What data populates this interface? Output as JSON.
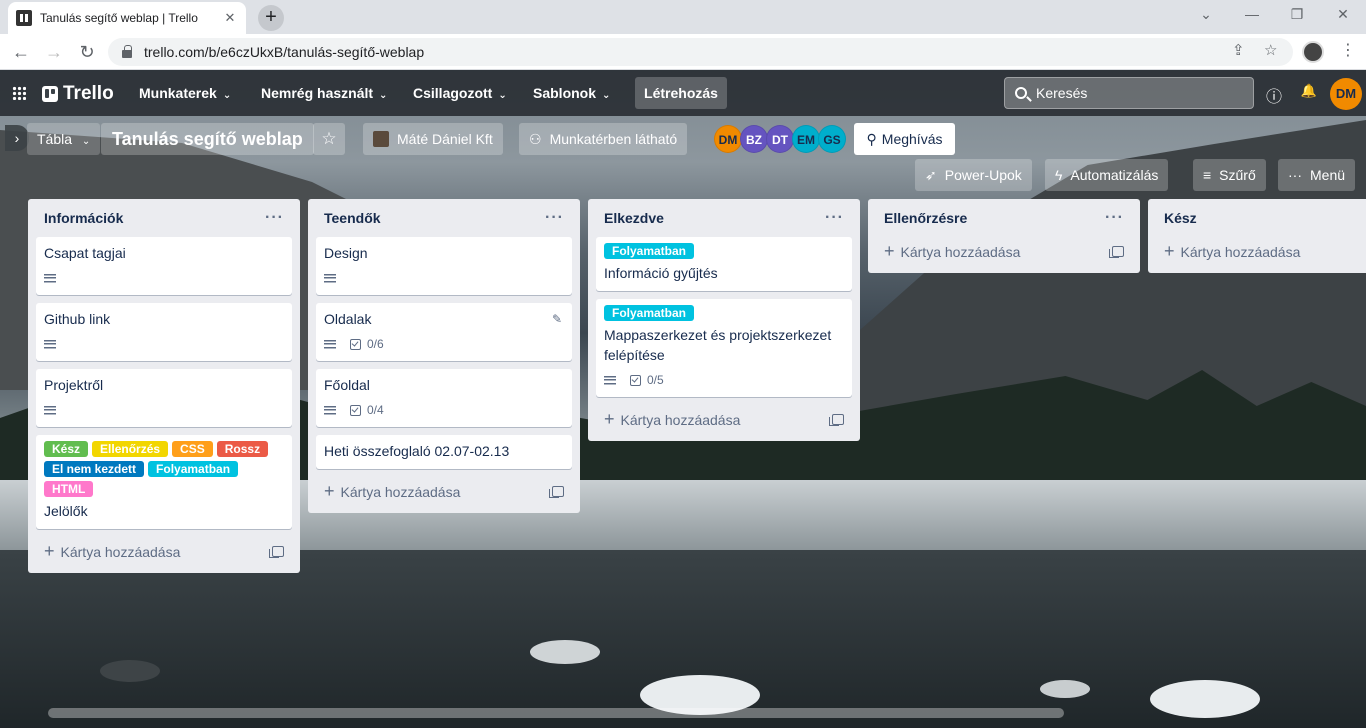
{
  "browser": {
    "tab_title": "Tanulás segítő weblap | Trello",
    "tab_close": "✕",
    "new_tab": "+",
    "url": "trello.com/b/e6czUkxB/tanulás-segítő-weblap",
    "win_minimize": "—",
    "win_restore": "❐",
    "win_close": "✕",
    "win_tabsearch": "⌄",
    "back": "←",
    "forward": "→",
    "reload": "↻",
    "share": "⇪",
    "star": "☆",
    "menu": "⋮"
  },
  "trello_header": {
    "logo": "Trello",
    "menus": [
      "Munkaterek",
      "Nemrég használt",
      "Csillagozott",
      "Sablonok"
    ],
    "create": "Létrehozás",
    "search_placeholder": "Keresés",
    "info": "ⓘ",
    "bell": "🔔",
    "user_initials": "DM"
  },
  "board_header": {
    "expand": "›",
    "view": "Tábla",
    "title": "Tanulás segítő weblap",
    "star": "☆",
    "workspace": "Máté Dániel Kft",
    "visibility": "Munkatérben látható",
    "members": [
      {
        "initials": "DM",
        "color": "#f18a00"
      },
      {
        "initials": "BZ",
        "color": "#6554c0"
      },
      {
        "initials": "DT",
        "color": "#6554c0"
      },
      {
        "initials": "EM",
        "color": "#00aecc"
      },
      {
        "initials": "GS",
        "color": "#00aecc"
      }
    ],
    "invite": "Meghívás",
    "powerups": "Power-Upok",
    "automation": "Automatizálás",
    "filter": "Szűrő",
    "menu": "Menü"
  },
  "lists": [
    {
      "title": "Információk",
      "cards": [
        {
          "title": "Csapat tagjai"
        },
        {
          "title": "Github link"
        },
        {
          "title": "Projektről"
        },
        {
          "title": "Jelölők",
          "labels": [
            {
              "text": "Kész",
              "color": "#61bd4f"
            },
            {
              "text": "Ellenőrzés",
              "color": "#f2d600"
            },
            {
              "text": "CSS",
              "color": "#ff9f1a"
            },
            {
              "text": "Rossz",
              "color": "#eb5a46"
            },
            {
              "text": "El nem kezdett",
              "color": "#0079bf"
            },
            {
              "text": "Folyamatban",
              "color": "#00c2e0"
            },
            {
              "text": "HTML",
              "color": "#ff78cb"
            }
          ]
        }
      ],
      "add": "Kártya hozzáadása"
    },
    {
      "title": "Teendők",
      "cards": [
        {
          "title": "Design"
        },
        {
          "title": "Oldalak",
          "checklist": "0/6"
        },
        {
          "title": "Főoldal",
          "checklist": "0/4"
        },
        {
          "title": "Heti összefoglaló 02.07-02.13"
        }
      ],
      "add": "Kártya hozzáadása"
    },
    {
      "title": "Elkezdve",
      "cards": [
        {
          "label": "Folyamatban",
          "title": "Információ gyűjtés"
        },
        {
          "label": "Folyamatban",
          "title": "Mappaszerkezet és projektszerkezet felépítése",
          "checklist": "0/5"
        }
      ],
      "add": "Kártya hozzáadása"
    },
    {
      "title": "Ellenőrzésre",
      "add": "Kártya hozzáadása"
    },
    {
      "title": "Kész",
      "add": "Kártya hozzáadása"
    }
  ],
  "ui": {
    "more": "···",
    "plus": "+",
    "pencil": "✎"
  }
}
